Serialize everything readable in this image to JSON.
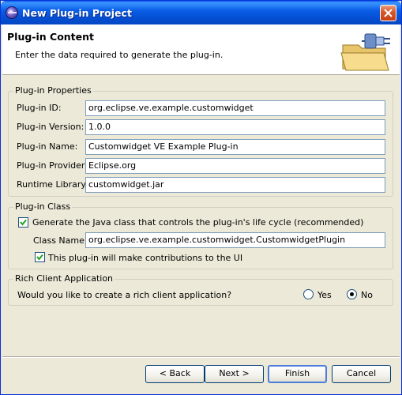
{
  "window": {
    "title": "New Plug-in Project"
  },
  "header": {
    "title": "Plug-in Content",
    "description": "Enter the data required to generate the plug-in."
  },
  "properties": {
    "group_title": "Plug-in Properties",
    "id_label": "Plug-in ID:",
    "id_value": "org.eclipse.ve.example.customwidget",
    "version_label": "Plug-in Version:",
    "version_value": "1.0.0",
    "name_label": "Plug-in Name:",
    "name_value": "Customwidget VE Example Plug-in",
    "provider_label": "Plug-in Provider:",
    "provider_value": "Eclipse.org",
    "library_label": "Runtime Library:",
    "library_value": "customwidget.jar"
  },
  "plugin_class": {
    "group_title": "Plug-in Class",
    "generate_label": "Generate the Java class that controls the plug-in's life cycle (recommended)",
    "generate_checked": true,
    "class_name_label": "Class Name:",
    "class_name_value": "org.eclipse.ve.example.customwidget.CustomwidgetPlugin",
    "contrib_label": "This plug-in will make contributions to the UI",
    "contrib_checked": true
  },
  "rich_client": {
    "group_title": "Rich Client Application",
    "question": "Would you like to create a rich client application?",
    "yes_label": "Yes",
    "no_label": "No",
    "selected": "No"
  },
  "buttons": {
    "back": "< Back",
    "next": "Next >",
    "finish": "Finish",
    "cancel": "Cancel"
  },
  "icons": {
    "app": "eclipse-icon",
    "close": "close-icon",
    "wizard": "plugin-folder-icon",
    "check": "checkmark-icon"
  }
}
